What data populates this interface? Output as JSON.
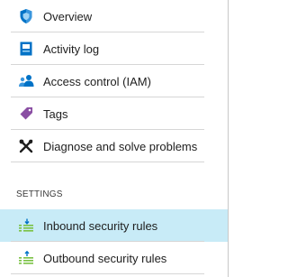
{
  "nav": {
    "items": [
      {
        "label": "Overview",
        "icon": "shield-icon"
      },
      {
        "label": "Activity log",
        "icon": "activity-log-icon"
      },
      {
        "label": "Access control (IAM)",
        "icon": "users-icon"
      },
      {
        "label": "Tags",
        "icon": "tag-icon"
      },
      {
        "label": "Diagnose and solve problems",
        "icon": "wrench-icon"
      }
    ]
  },
  "settings": {
    "header": "SETTINGS",
    "items": [
      {
        "label": "Inbound security rules",
        "icon": "inbound-rules-icon",
        "selected": true
      },
      {
        "label": "Outbound security rules",
        "icon": "outbound-rules-icon",
        "selected": false
      }
    ]
  },
  "colors": {
    "selected_background": "#c8ebf7",
    "accent_blue": "#0072c6",
    "tag_purple": "#8a4ea3"
  }
}
